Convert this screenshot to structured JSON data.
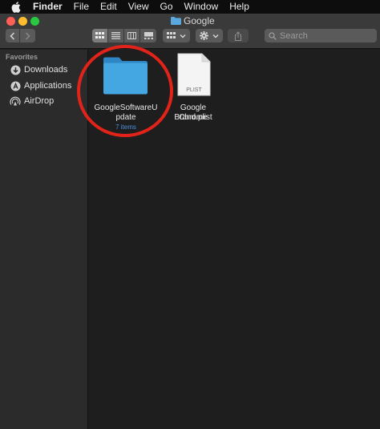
{
  "menubar": {
    "app": "Finder",
    "items": [
      "File",
      "Edit",
      "View",
      "Go",
      "Window",
      "Help"
    ]
  },
  "window": {
    "title": "Google",
    "search_placeholder": "Search"
  },
  "sidebar": {
    "heading": "Favorites",
    "items": [
      {
        "label": "Downloads",
        "icon": "downloads-icon"
      },
      {
        "label": "Applications",
        "icon": "applications-icon"
      },
      {
        "label": "AirDrop",
        "icon": "airdrop-icon"
      }
    ]
  },
  "files": [
    {
      "name_line1": "GoogleSoftwareU",
      "name_line2": "pdate",
      "sub": "7 items",
      "kind": "folder"
    },
    {
      "name_line1": "Google Chrome",
      "name_line2": "Brand.plist",
      "badge": "PLIST",
      "kind": "plist"
    }
  ],
  "colors": {
    "menubar": "#0d0d0d",
    "toolbar": "#3a3a3a",
    "sidebar": "#2b2b2b",
    "content": "#1e1e1e",
    "folder": "#3da0dc",
    "accent_text": "#4a90d9",
    "annotation": "#e2231a"
  }
}
